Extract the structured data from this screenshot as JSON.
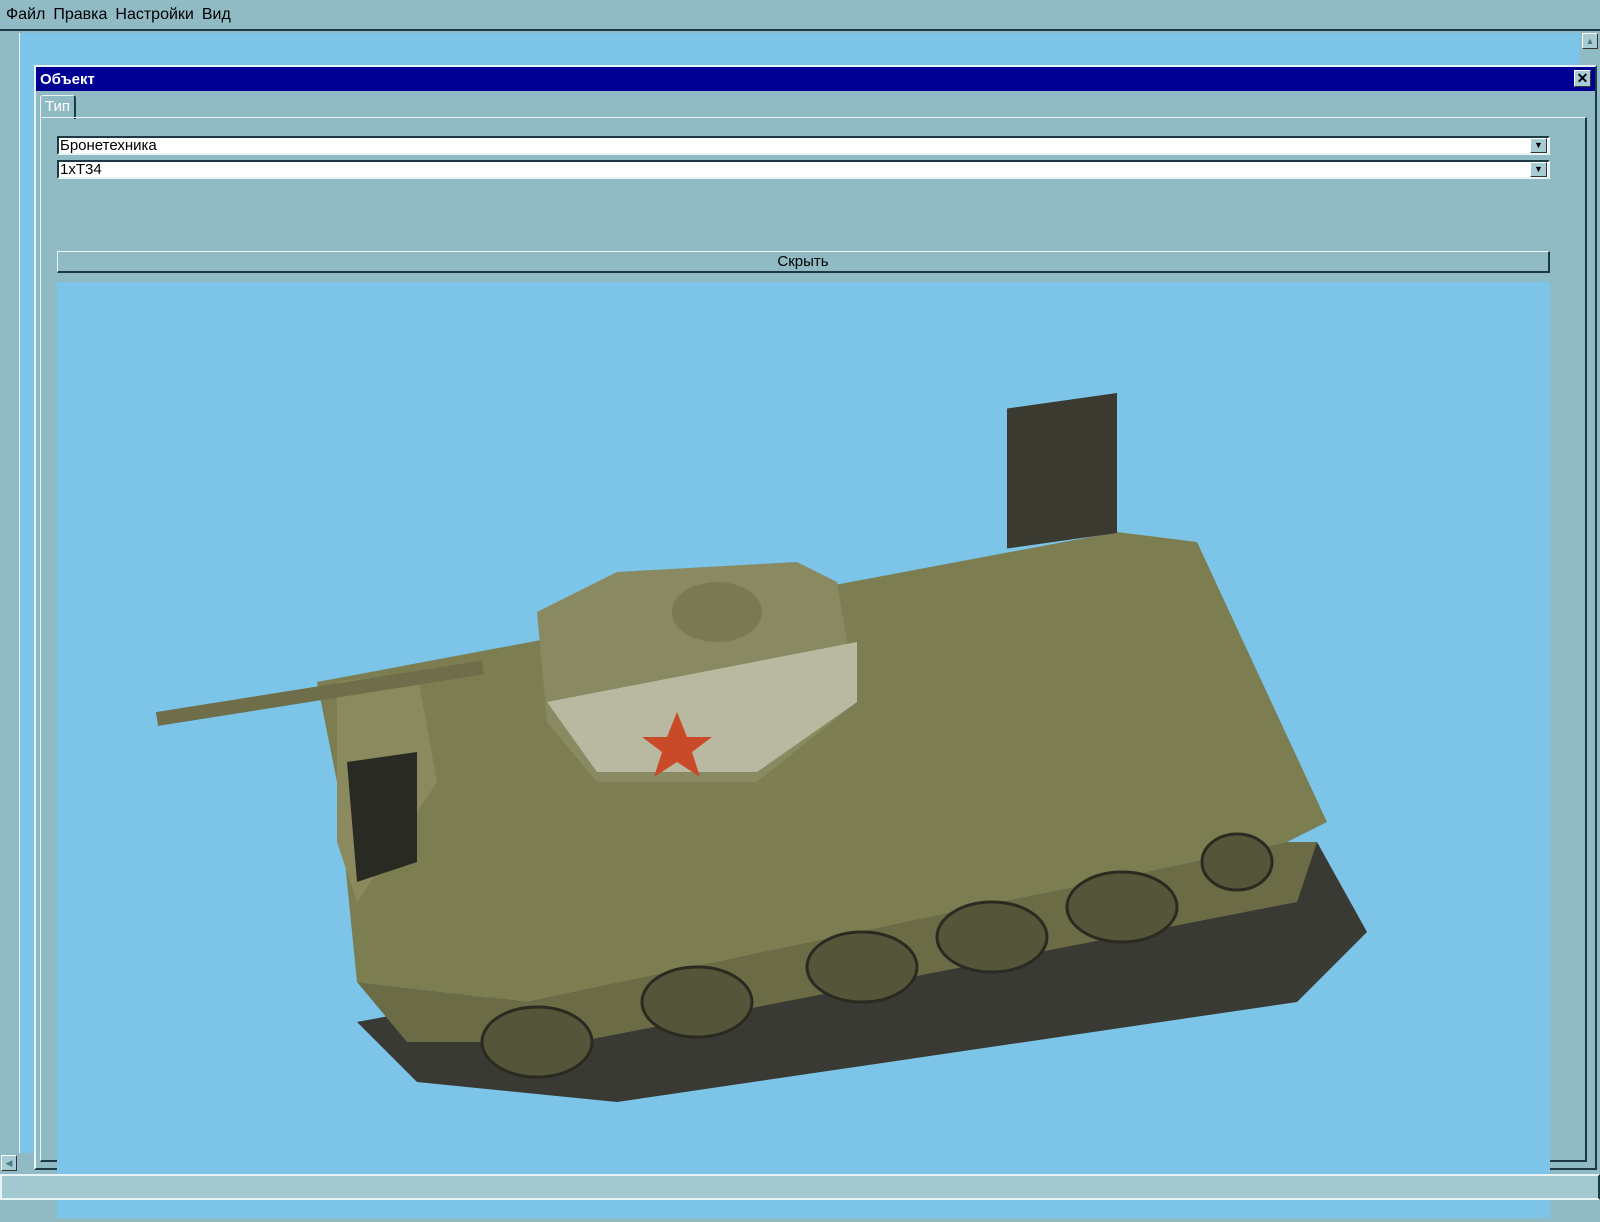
{
  "menu": [
    "Файл",
    "Правка",
    "Настройки",
    "Вид"
  ],
  "dialog": {
    "title": "Объект",
    "tab": "Тип",
    "category": "Бронетехника",
    "unit": "1xT34",
    "hide_button": "Скрыть"
  },
  "colors": {
    "titlebar": "#000094",
    "background": "#7cc4e8",
    "chrome": "#90bac4"
  }
}
